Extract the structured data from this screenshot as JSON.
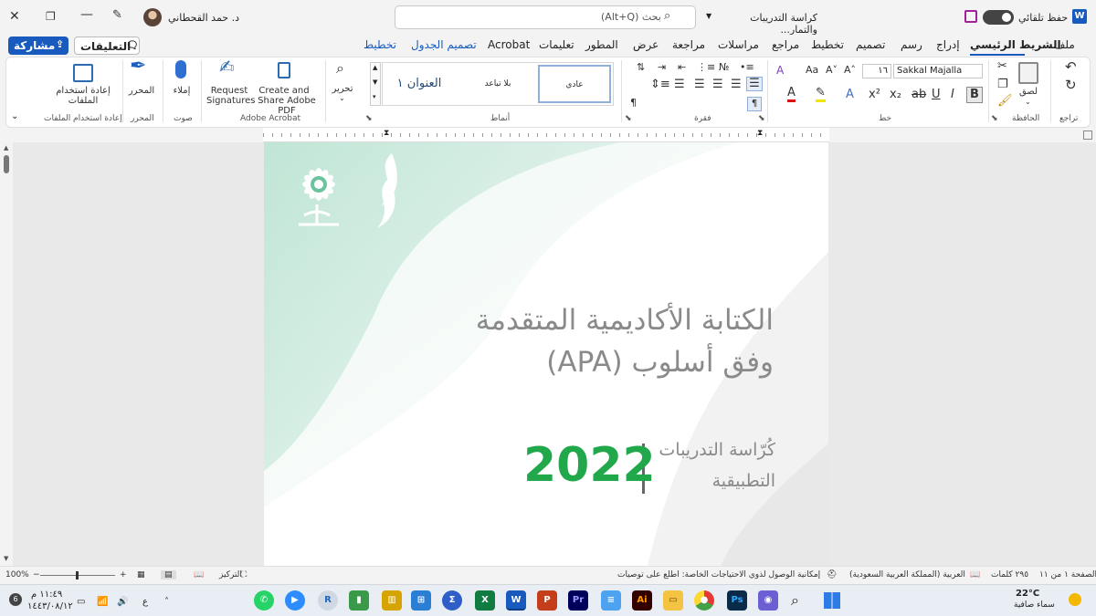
{
  "titlebar": {
    "autosave_label": "حفظ تلقائي",
    "doc_title": "كراسة التدريبات والتمار...",
    "search_placeholder": "بحث (Alt+Q)",
    "user_name": "د. حمد القحطاني"
  },
  "menu": {
    "file": "ملف",
    "home": "الشريط الرئيسي",
    "insert": "إدراج",
    "draw": "رسم",
    "design": "تصميم",
    "layout": "تخطيط",
    "references": "مراجع",
    "mailings": "مراسلات",
    "review": "مراجعة",
    "view": "عرض",
    "developer": "المطور",
    "help": "تعليمات",
    "acrobat": "Acrobat",
    "table_design": "تصميم الجدول",
    "table_layout": "تخطيط",
    "comments": "التعليقات",
    "share": "مشاركة"
  },
  "ribbon": {
    "undo_group": "تراجع",
    "clipboard_group": "الحافظة",
    "paste_label": "لصق",
    "font_group": "خط",
    "font_name": "Sakkal Majalla",
    "font_size": "١٦",
    "paragraph_group": "فقرة",
    "styles_group": "أنماط",
    "style_normal": "عادي",
    "style_nospacing": "بلا تباعد",
    "style_heading1": "العنوان ١",
    "editing_label": "تحرير",
    "acrobat_group": "Adobe Acrobat",
    "create_pdf_line1": "Create and",
    "create_pdf_line2": "Share Adobe PDF",
    "request_sig_line1": "Request",
    "request_sig_line2": "Signatures",
    "voice_group": "صوت",
    "dictate_label": "إملاء",
    "editor_group": "المحرر",
    "editor_label": "المحرر",
    "reuse_group": "إعادة استخدام الملفات",
    "reuse_line1": "إعادة استخدام",
    "reuse_line2": "الملفات"
  },
  "document": {
    "title_line1": "الكتابة الأكاديمية المتقدمة",
    "title_line2": "وفق أسلوب (APA)",
    "booklet_line1": "كُرّاسة التدريبات",
    "booklet_line2": "التطبيقية",
    "year": "2022"
  },
  "status": {
    "page": "الصفحة ١ من ١١",
    "words": "٢٩٥ كلمات",
    "language": "العربية (المملكة العربية السعودية)",
    "accessibility": "إمكانية الوصول لذوي الاحتياجات الخاصة: اطلع على توصيات",
    "focus": "التركيز",
    "zoom": "100%"
  },
  "taskbar": {
    "temperature": "22°C",
    "weather": "سماء صافية",
    "time": "١١:٤٩ م",
    "date": "١٤٤٣/٠٨/١٢",
    "lang": "ع",
    "notifications": "6"
  },
  "colors": {
    "accent": "#185abd",
    "year_green": "#21a84a",
    "wave_teal": "#7fcaa8"
  }
}
